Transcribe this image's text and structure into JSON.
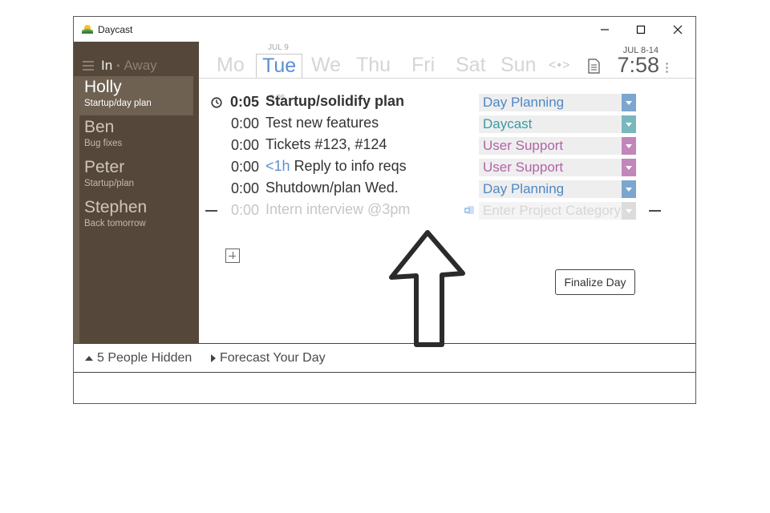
{
  "window": {
    "title": "Daycast",
    "controls": {
      "minimize": "—",
      "maximize": "☐",
      "close": "✕"
    }
  },
  "sidebar": {
    "presence": {
      "in_label": "In",
      "separator": "•",
      "away_label": "Away"
    },
    "people": [
      {
        "name": "Holly",
        "status": "Startup/day plan",
        "selected": true
      },
      {
        "name": "Ben",
        "status": "Bug fixes",
        "selected": false
      },
      {
        "name": "Peter",
        "status": "Startup/plan",
        "selected": false
      },
      {
        "name": "Stephen",
        "status": "Back tomorrow",
        "selected": false
      }
    ]
  },
  "header": {
    "date_note": "JUL 9",
    "days": [
      "Mo",
      "Tue",
      "We",
      "Thu",
      "Fri",
      "Sat",
      "Sun"
    ],
    "selected_day": "Tue",
    "selected_total": "0:05",
    "nav_arrows": "<•>",
    "week_range": "JUL 8-14",
    "clock": "7:58"
  },
  "tasks": [
    {
      "time": "0:05",
      "estimate": "",
      "title": "Startup/solidify plan",
      "category": "Day Planning",
      "category_color": "#4f86c6",
      "drop_color": "#7ba6cf",
      "active": true,
      "faded": false
    },
    {
      "time": "0:00",
      "estimate": "",
      "title": "Test new features",
      "category": "Daycast",
      "category_color": "#3a9aa6",
      "drop_color": "#79b7bf",
      "active": false,
      "faded": false
    },
    {
      "time": "0:00",
      "estimate": "",
      "title": "Tickets #123, #124",
      "category": "User Support",
      "category_color": "#b064a6",
      "drop_color": "#c286bb",
      "active": false,
      "faded": false
    },
    {
      "time": "0:00",
      "estimate": "<1h",
      "title": "Reply to info reqs",
      "category": "User Support",
      "category_color": "#b064a6",
      "drop_color": "#c286bb",
      "active": false,
      "faded": false
    },
    {
      "time": "0:00",
      "estimate": "",
      "title": "Shutdown/plan Wed.",
      "category": "Day Planning",
      "category_color": "#4f86c6",
      "drop_color": "#7ba6cf",
      "active": false,
      "faded": false
    },
    {
      "time": "0:00",
      "estimate": "",
      "title": "Intern interview @3pm",
      "category": "Enter Project Category",
      "category_color": "#d6d6d6",
      "drop_color": "#dcdcdc",
      "active": false,
      "faded": true
    }
  ],
  "actions": {
    "finalize_label": "Finalize Day"
  },
  "footer": {
    "hidden_people": "5 People Hidden",
    "forecast": "Forecast Your Day"
  }
}
